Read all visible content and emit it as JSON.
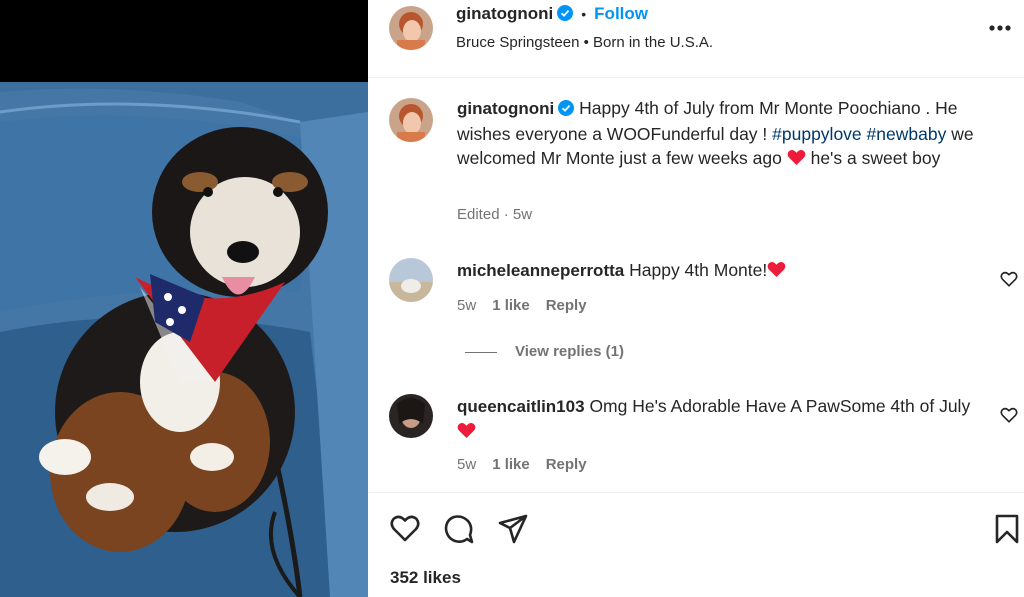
{
  "post": {
    "author": "ginatognoni",
    "separator": "•",
    "follow_label": "Follow",
    "audio": "Bruce Springsteen • Born in the U.S.A.",
    "caption": {
      "part1": "Happy 4th of July from Mr Monte Poochiano . He wishes everyone a WOOFunderful day ! ",
      "hashtag1": "#puppylove",
      "hashtag2": "#newbaby",
      "part2": " we welcomed Mr Monte just a few weeks ago ",
      "part3": "  he's a sweet boy"
    },
    "caption_meta": "Edited · 5w",
    "likes": "352 likes"
  },
  "comments": [
    {
      "username": "micheleanneperrotta",
      "text": "Happy 4th Monte!",
      "time": "5w",
      "likes": "1 like",
      "reply": "Reply"
    },
    {
      "username": "queencaitlin103",
      "text": "Omg He's Adorable Have A PawSome 4th of July",
      "time": "5w",
      "likes": "1 like",
      "reply": "Reply"
    }
  ],
  "view_replies": "View replies (1)",
  "icons": {
    "like": "heart-icon",
    "comment": "comment-icon",
    "share": "share-icon",
    "save": "bookmark-icon",
    "more": "more-options-icon",
    "verified": "verified-badge-icon"
  },
  "colors": {
    "link": "#0095f6",
    "hashtag": "#00376b",
    "secondary_text": "#737373",
    "heart_emoji": "#ed1c3b"
  }
}
